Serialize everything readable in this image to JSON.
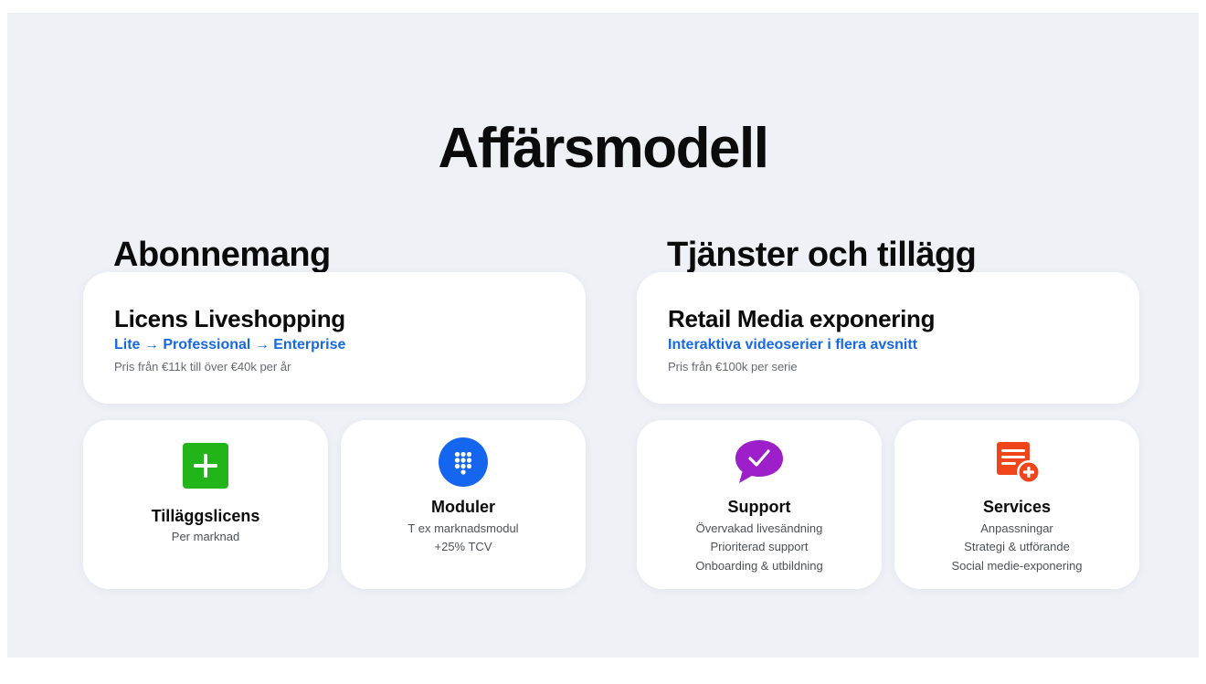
{
  "title": "Affärsmodell",
  "left_column": {
    "heading": "Abonnemang",
    "main_card": {
      "title": "Licens Liveshopping",
      "subtitle": "Lite → Professional → Enterprise",
      "price": "Pris från €11k till över €40k per år"
    },
    "cards": [
      {
        "icon": "plus-icon",
        "icon_color": "#22b51a",
        "name": "Tilläggslicens",
        "lines": [
          "Per marknad"
        ]
      },
      {
        "icon": "grid-dots-icon",
        "icon_color": "#1466ee",
        "name": "Moduler",
        "lines": [
          "T ex marknadsmodul",
          "+25% TCV"
        ]
      }
    ]
  },
  "right_column": {
    "heading": "Tjänster och tillägg",
    "main_card": {
      "title": "Retail Media exponering",
      "subtitle": "Interaktiva videoserier i flera avsnitt",
      "price": "Pris från €100k per serie"
    },
    "cards": [
      {
        "icon": "check-bubble-icon",
        "icon_color": "#9c1fc9",
        "name": "Support",
        "lines": [
          "Övervakad livesändning",
          "Prioriterad support",
          "Onboarding & utbildning"
        ]
      },
      {
        "icon": "document-plus-icon",
        "icon_color": "#f0441a",
        "name": "Services",
        "lines": [
          "Anpassningar",
          "Strategi & utförande",
          "Social medie-exponering"
        ]
      }
    ]
  },
  "colors": {
    "background": "#eef1f6",
    "card": "#ffffff",
    "accent_blue": "#1668e3"
  }
}
